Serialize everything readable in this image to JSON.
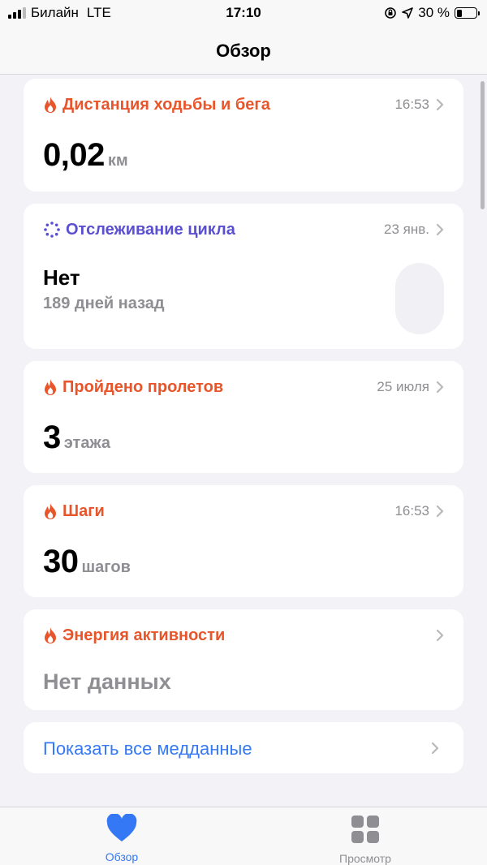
{
  "status_bar": {
    "carrier": "Билайн",
    "network": "LTE",
    "time": "17:10",
    "battery": "30 %",
    "battery_level": 0.3
  },
  "nav": {
    "title": "Обзор"
  },
  "cards": {
    "distance": {
      "title": "Дистанция ходьбы и бега",
      "time": "16:53",
      "value": "0,02",
      "unit": "км"
    },
    "cycle": {
      "title": "Отслеживание цикла",
      "time": "23 янв.",
      "value": "Нет",
      "sub": "189 дней назад"
    },
    "flights": {
      "title": "Пройдено пролетов",
      "time": "25 июля",
      "value": "3",
      "unit": "этажа"
    },
    "steps": {
      "title": "Шаги",
      "time": "16:53",
      "value": "30",
      "unit": "шагов"
    },
    "energy": {
      "title": "Энергия активности",
      "value": "Нет данных"
    }
  },
  "show_all": {
    "label": "Показать все медданные"
  },
  "tabs": [
    {
      "label": "Обзор",
      "icon": "heart-icon",
      "active": true
    },
    {
      "label": "Просмотр",
      "icon": "grid-icon",
      "active": false
    }
  ],
  "colors": {
    "accent": "#3478f6",
    "activity": "#e8552b",
    "cycle": "#5a4fd0"
  }
}
